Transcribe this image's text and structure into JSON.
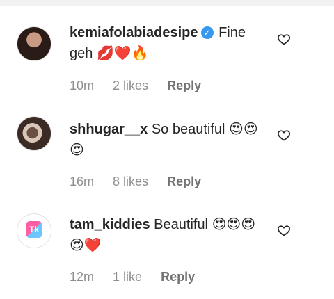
{
  "comments": [
    {
      "username": "kemiafolabiadesipe",
      "text": "Fine geh",
      "emoji": "💋❤️🔥",
      "time": "10m",
      "likes": "2 likes",
      "reply": "Reply",
      "verified": true
    },
    {
      "username": "shhugar__x",
      "text": "So beautiful",
      "emoji": "😍😍😍",
      "time": "16m",
      "likes": "8 likes",
      "reply": "Reply",
      "verified": false
    },
    {
      "username": "tam_kiddies",
      "text": "Beautiful",
      "emoji": "😍😍😍😍❤️",
      "time": "12m",
      "likes": "1 like",
      "reply": "Reply",
      "verified": false
    }
  ],
  "avatar_logo": {
    "text": "Tk",
    "small": "Tam Kiddies"
  },
  "icons": {
    "verified": "verified-badge-icon",
    "like": "heart-outline-icon"
  },
  "colors": {
    "verified": "#3797f0",
    "meta": "#8e8e8e"
  }
}
